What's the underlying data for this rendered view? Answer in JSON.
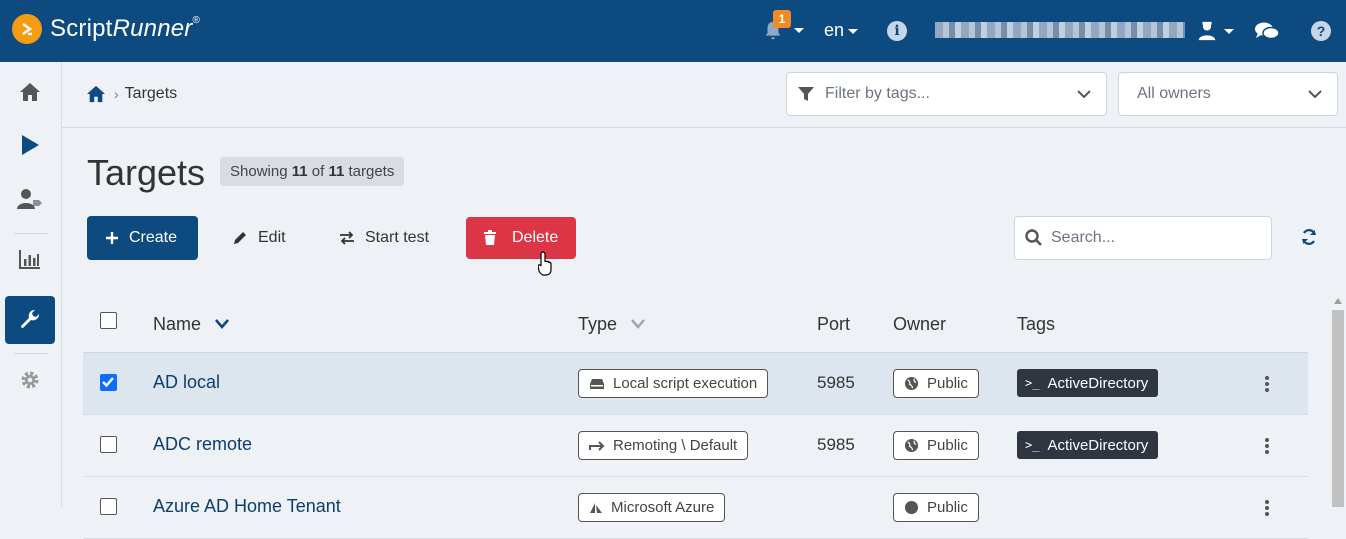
{
  "header": {
    "brand_a": "Script",
    "brand_b": "Runner",
    "brand_reg": "®",
    "notification_count": "1",
    "language": "en",
    "info_icon": "info-icon",
    "help_icon": "question-icon"
  },
  "sidebar": {
    "items": [
      {
        "name": "home",
        "icon": "home-icon"
      },
      {
        "name": "run",
        "icon": "play-icon"
      },
      {
        "name": "users",
        "icon": "user-tag-icon"
      },
      {
        "name": "reports",
        "icon": "chart-icon"
      },
      {
        "name": "configuration",
        "icon": "wrench-icon",
        "active": true
      },
      {
        "name": "settings",
        "icon": "gear-icon"
      }
    ]
  },
  "breadcrumb": {
    "current": "Targets"
  },
  "filters": {
    "tags_placeholder": "Filter by tags...",
    "owners_value": "All owners"
  },
  "page": {
    "title": "Targets",
    "showing_prefix": "Showing",
    "showing_count": "11",
    "showing_of": "of",
    "showing_total": "11",
    "showing_suffix": "targets"
  },
  "toolbar": {
    "create": "Create",
    "edit": "Edit",
    "start_test": "Start test",
    "delete": "Delete",
    "search_placeholder": "Search..."
  },
  "table": {
    "columns": {
      "name": "Name",
      "type": "Type",
      "port": "Port",
      "owner": "Owner",
      "tags": "Tags"
    },
    "rows": [
      {
        "selected": true,
        "name": "AD local",
        "type": "Local script execution",
        "type_icon": "drive-icon",
        "port": "5985",
        "owner": "Public",
        "tag": "ActiveDirectory"
      },
      {
        "selected": false,
        "name": "ADC remote",
        "type": "Remoting \\ Default",
        "type_icon": "arrow-right-icon",
        "port": "5985",
        "owner": "Public",
        "tag": "ActiveDirectory"
      },
      {
        "selected": false,
        "name": "Azure AD Home Tenant",
        "type": "Microsoft Azure",
        "type_icon": "azure-icon",
        "port": "",
        "owner": "Public",
        "tag": ""
      }
    ]
  },
  "colors": {
    "primary": "#0d4a80",
    "danger": "#dc3545",
    "accent": "#f39c12",
    "tag_bg": "#2f3640"
  }
}
